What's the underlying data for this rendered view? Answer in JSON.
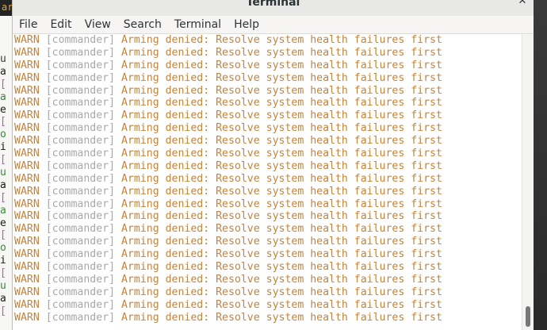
{
  "window": {
    "title": "Terminal"
  },
  "menu": [
    "File",
    "Edit",
    "View",
    "Search",
    "Terminal",
    "Help"
  ],
  "background_window": {
    "title_fragment": "ard",
    "lines": [
      {
        "t": "u",
        "c": "#3a3a3a"
      },
      {
        "t": "a",
        "c": "#1a1a1a"
      },
      {
        "t": "[",
        "c": "#b25ba8"
      },
      {
        "t": "a",
        "c": "#3a8a3a"
      },
      {
        "t": "e",
        "c": "#1a1a1a"
      },
      {
        "t": "[",
        "c": "#b25ba8"
      },
      {
        "t": "o",
        "c": "#3a8a3a"
      },
      {
        "t": "i",
        "c": "#1a1a1a"
      },
      {
        "t": "[",
        "c": "#b25ba8"
      },
      {
        "t": "u",
        "c": "#3a8a3a"
      },
      {
        "t": "a",
        "c": "#1a1a1a"
      },
      {
        "t": "[",
        "c": "#b25ba8"
      },
      {
        "t": "a",
        "c": "#3a8a3a"
      },
      {
        "t": "e",
        "c": "#1a1a1a"
      },
      {
        "t": "[",
        "c": "#b25ba8"
      },
      {
        "t": "o",
        "c": "#3a8a3a"
      },
      {
        "t": "i",
        "c": "#1a1a1a"
      },
      {
        "t": "[",
        "c": "#b25ba8"
      },
      {
        "t": "u",
        "c": "#3a8a3a"
      },
      {
        "t": "a",
        "c": "#1a1a1a"
      },
      {
        "t": "[",
        "c": "#b25ba8"
      }
    ]
  },
  "terminal": {
    "colors": {
      "level": "#c4833b",
      "module": "#a8a8a8",
      "message": "#c4833b",
      "background": "#ffffff"
    },
    "log_lines": [
      {
        "level": "WARN",
        "module": "[commander]",
        "message": "Arming denied: Resolve system health failures first"
      },
      {
        "level": "WARN",
        "module": "[commander]",
        "message": "Arming denied: Resolve system health failures first"
      },
      {
        "level": "WARN",
        "module": "[commander]",
        "message": "Arming denied: Resolve system health failures first"
      },
      {
        "level": "WARN",
        "module": "[commander]",
        "message": "Arming denied: Resolve system health failures first"
      },
      {
        "level": "WARN",
        "module": "[commander]",
        "message": "Arming denied: Resolve system health failures first"
      },
      {
        "level": "WARN",
        "module": "[commander]",
        "message": "Arming denied: Resolve system health failures first"
      },
      {
        "level": "WARN",
        "module": "[commander]",
        "message": "Arming denied: Resolve system health failures first"
      },
      {
        "level": "WARN",
        "module": "[commander]",
        "message": "Arming denied: Resolve system health failures first"
      },
      {
        "level": "WARN",
        "module": "[commander]",
        "message": "Arming denied: Resolve system health failures first"
      },
      {
        "level": "WARN",
        "module": "[commander]",
        "message": "Arming denied: Resolve system health failures first"
      },
      {
        "level": "WARN",
        "module": "[commander]",
        "message": "Arming denied: Resolve system health failures first"
      },
      {
        "level": "WARN",
        "module": "[commander]",
        "message": "Arming denied: Resolve system health failures first"
      },
      {
        "level": "WARN",
        "module": "[commander]",
        "message": "Arming denied: Resolve system health failures first"
      },
      {
        "level": "WARN",
        "module": "[commander]",
        "message": "Arming denied: Resolve system health failures first"
      },
      {
        "level": "WARN",
        "module": "[commander]",
        "message": "Arming denied: Resolve system health failures first"
      },
      {
        "level": "WARN",
        "module": "[commander]",
        "message": "Arming denied: Resolve system health failures first"
      },
      {
        "level": "WARN",
        "module": "[commander]",
        "message": "Arming denied: Resolve system health failures first"
      },
      {
        "level": "WARN",
        "module": "[commander]",
        "message": "Arming denied: Resolve system health failures first"
      },
      {
        "level": "WARN",
        "module": "[commander]",
        "message": "Arming denied: Resolve system health failures first"
      },
      {
        "level": "WARN",
        "module": "[commander]",
        "message": "Arming denied: Resolve system health failures first"
      },
      {
        "level": "WARN",
        "module": "[commander]",
        "message": "Arming denied: Resolve system health failures first"
      },
      {
        "level": "WARN",
        "module": "[commander]",
        "message": "Arming denied: Resolve system health failures first"
      },
      {
        "level": "WARN",
        "module": "[commander]",
        "message": "Arming denied: Resolve system health failures first"
      }
    ]
  },
  "icons": {
    "close": "close-icon"
  }
}
